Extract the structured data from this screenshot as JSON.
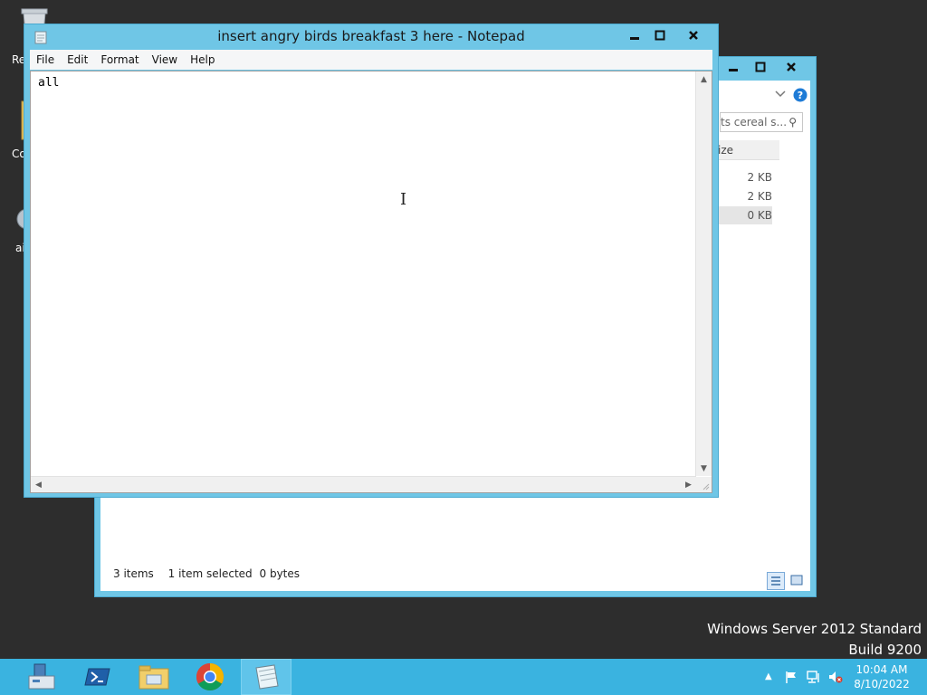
{
  "desktop": {
    "icons": [
      {
        "label": "Rec",
        "icon": "recycle-bin-icon"
      },
      {
        "label": "Co",
        "icon": "folder-icon"
      },
      {
        "label": "ai",
        "icon": "gear-icon"
      }
    ]
  },
  "explorer": {
    "search_placeholder": "ts cereal s...",
    "column_header": "ize",
    "sizes": [
      "2 KB",
      "2 KB",
      "0 KB"
    ],
    "status": {
      "items": "3 items",
      "selected": "1 item selected",
      "bytes": "0 bytes"
    }
  },
  "notepad": {
    "title": "insert angry birds breakfast 3 here - Notepad",
    "menu": [
      "File",
      "Edit",
      "Format",
      "View",
      "Help"
    ],
    "content": "all"
  },
  "watermark": {
    "line1": "Windows Server 2012 Standard",
    "line2": "Build 9200"
  },
  "taskbar": {
    "apps": [
      "server-manager-icon",
      "powershell-icon",
      "file-explorer-icon",
      "chrome-icon",
      "notepad-icon"
    ],
    "clock": {
      "time": "10:04 AM",
      "date": "8/10/2022"
    }
  },
  "colors": {
    "window_frame": "#6fc6e6",
    "taskbar": "#3ab3e0",
    "desktop": "#2d2d2d"
  }
}
